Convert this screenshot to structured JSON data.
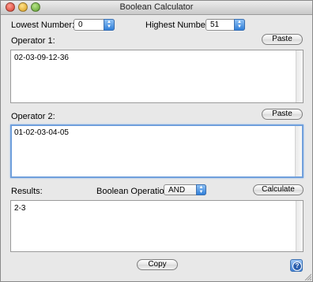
{
  "window": {
    "title": "Boolean Calculator"
  },
  "range": {
    "lowest_label": "Lowest Number:",
    "lowest_value": "0",
    "highest_label": "Highest Number:",
    "highest_value": "51"
  },
  "operator1": {
    "label": "Operator 1:",
    "paste_label": "Paste",
    "value": "02-03-09-12-36"
  },
  "operator2": {
    "label": "Operator 2:",
    "paste_label": "Paste",
    "value": "01-02-03-04-05"
  },
  "results": {
    "label": "Results:",
    "operation_label": "Boolean Operation:",
    "operation_value": "AND",
    "calculate_label": "Calculate",
    "value": "2-3"
  },
  "footer": {
    "copy_label": "Copy",
    "help_glyph": "?"
  },
  "icons": {
    "close": "close-icon",
    "minimize": "minimize-icon",
    "zoom": "zoom-icon",
    "help": "help-icon",
    "resize": "resize-grip-icon",
    "stepper_arrows": "up-down-arrows-icon"
  },
  "colors": {
    "window_bg": "#e8e8e8",
    "accent_blue": "#2f7ed8",
    "focus_ring": "#6f9fdc"
  }
}
